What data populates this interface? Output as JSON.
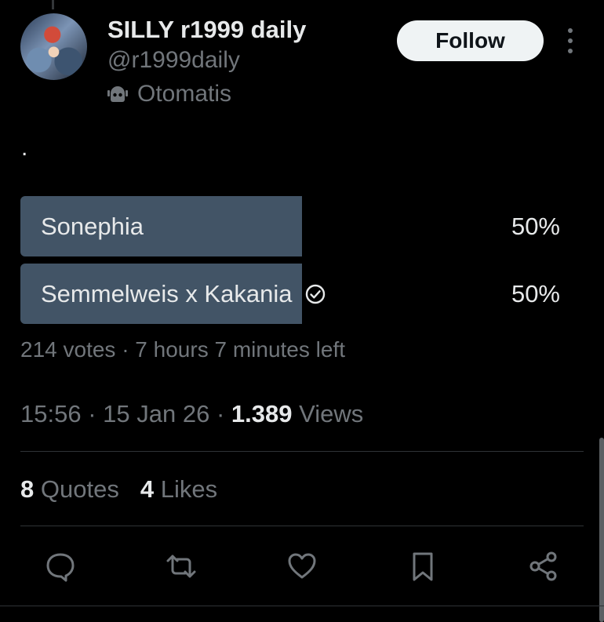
{
  "author": {
    "display_name": "SILLY r1999 daily",
    "handle": "@r1999daily",
    "affiliation": "Otomatis",
    "follow_label": "Follow"
  },
  "tweet": {
    "text": "."
  },
  "poll": {
    "options": [
      {
        "label": "Sonephia",
        "percent": "50%",
        "fill_fraction": 0.5,
        "selected": false
      },
      {
        "label": "Semmelweis x Kakania",
        "percent": "50%",
        "fill_fraction": 0.5,
        "selected": true
      }
    ],
    "meta": "214 votes · 7 hours 7 minutes left"
  },
  "timestamp": {
    "time": "15:56",
    "date": "15 Jan 26",
    "views_count": "1.389",
    "views_label": "Views"
  },
  "stats": {
    "quotes_count": "8",
    "quotes_label": "Quotes",
    "likes_count": "4",
    "likes_label": "Likes"
  },
  "actions": [
    "reply-icon",
    "retweet-icon",
    "like-icon",
    "bookmark-icon",
    "share-icon"
  ],
  "colors": {
    "background": "#000000",
    "poll_fill": "#425466",
    "muted_text": "#71767b",
    "primary_text": "#e7e9ea",
    "follow_bg": "#eff3f4"
  }
}
